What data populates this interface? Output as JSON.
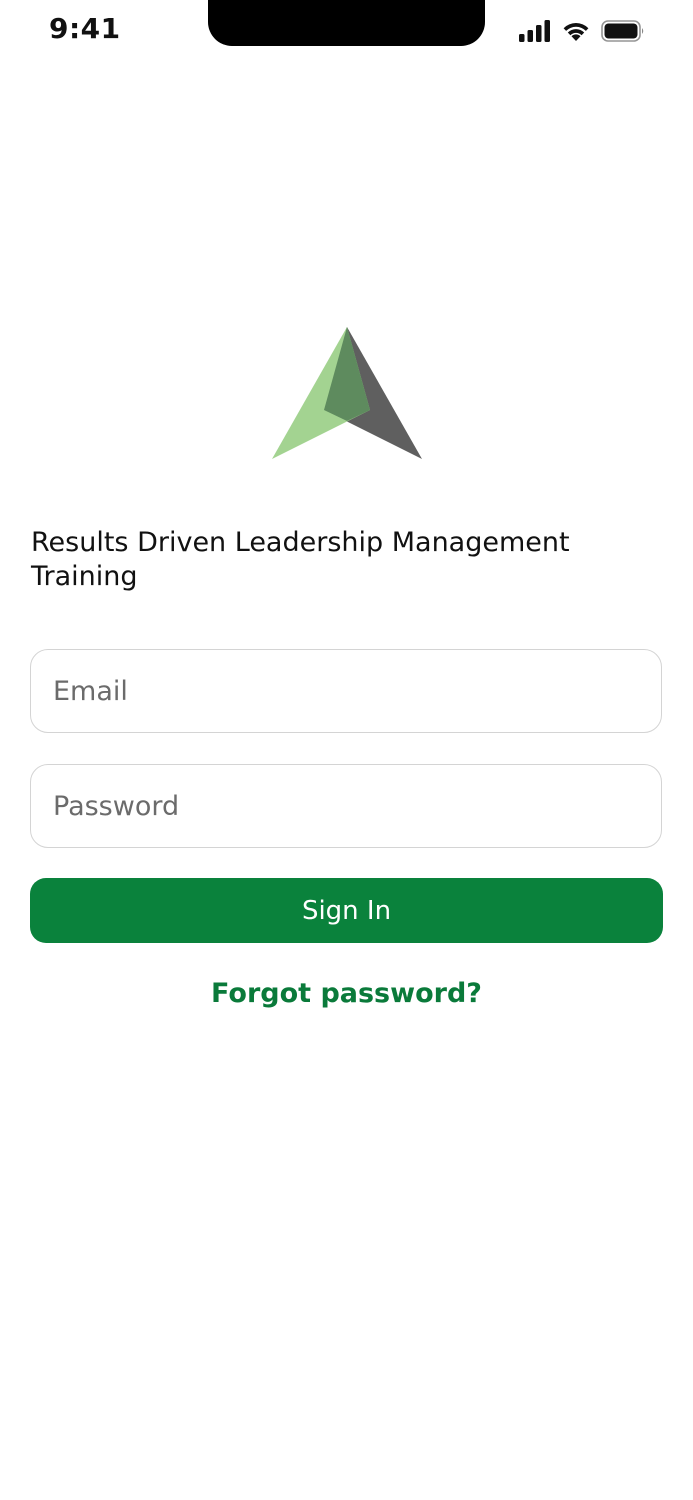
{
  "status_bar": {
    "time": "9:41"
  },
  "app": {
    "title": "Results Driven Leadership Management Training"
  },
  "form": {
    "email": {
      "value": "",
      "placeholder": "Email"
    },
    "password": {
      "value": "",
      "placeholder": "Password"
    },
    "sign_in_label": "Sign In",
    "forgot_password_label": "Forgot password?"
  },
  "icons": {
    "signal": "cellular-signal-icon",
    "wifi": "wifi-icon",
    "battery": "battery-icon",
    "logo": "logo-icon"
  },
  "colors": {
    "accent": "#0a823c",
    "link": "#0a7a3a",
    "logo_light_green": "#a3d391",
    "logo_dark_green": "#5e8b5e",
    "logo_gray": "#5f5f5f"
  }
}
